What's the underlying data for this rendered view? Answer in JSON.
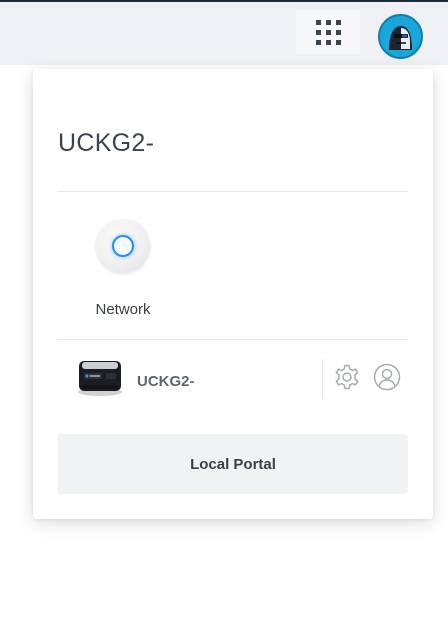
{
  "topbar": {
    "apps_icon": "apps-grid-icon",
    "avatar_icon": "user-avatar-icon"
  },
  "panel": {
    "controller_name": "UCKG2-",
    "apps": [
      {
        "label": "Network",
        "icon": "network-app-icon",
        "accent": "#1f8ff2"
      }
    ],
    "device": {
      "name": "UCKG2-",
      "image": "cloud-key-device-icon",
      "actions": [
        "gear-icon",
        "user-icon"
      ]
    },
    "portal_button": "Local Portal"
  },
  "colors": {
    "topbar_bg": "#eef0f3",
    "accent": "#1f8ff2",
    "text": "#3a3f47"
  }
}
